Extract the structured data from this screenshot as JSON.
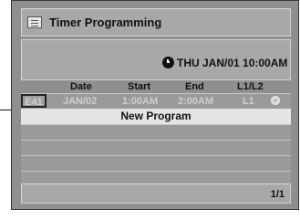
{
  "title": "Timer Programming",
  "clock": "THU JAN/01 10:00AM",
  "columns": [
    "Date",
    "Start",
    "End",
    "L1/L2"
  ],
  "program": {
    "code": "E41",
    "date": "JAN/02",
    "start": "1:00AM",
    "end": "2:00AM",
    "input": "L1"
  },
  "new_program": "New Program",
  "page": "1/1",
  "icons": {
    "title": "list-icon",
    "clock": "clock-icon",
    "media": "disc-icon"
  }
}
